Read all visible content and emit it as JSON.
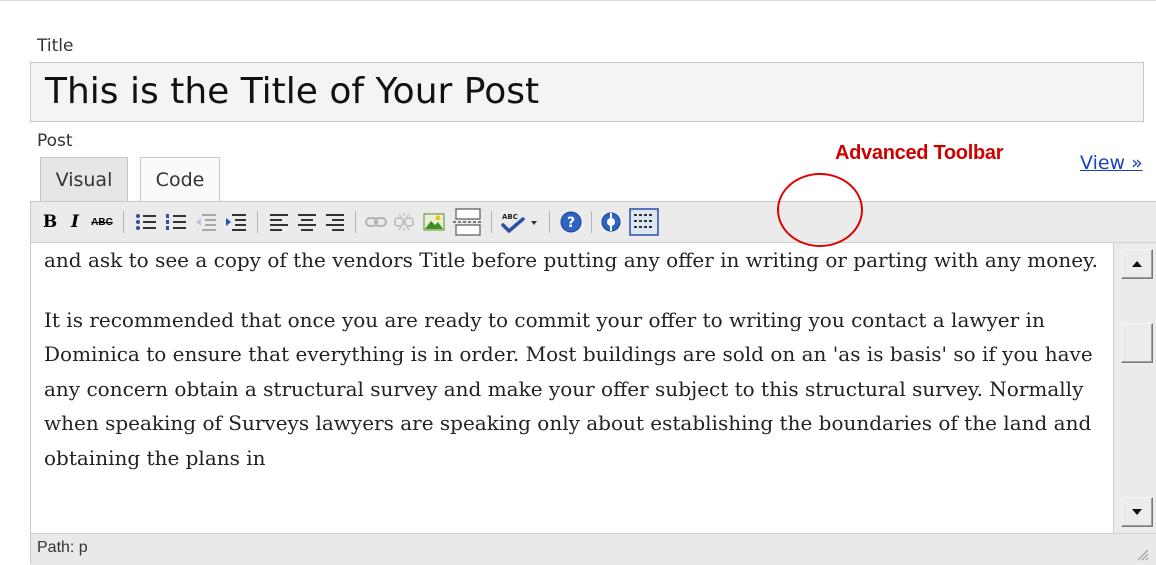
{
  "title_field": {
    "label": "Title",
    "value": "This is the Title of Your Post"
  },
  "post_field": {
    "label": "Post",
    "tabs": [
      {
        "label": "Visual",
        "active": true
      },
      {
        "label": "Code",
        "active": false
      }
    ],
    "view_link": "View »"
  },
  "annotation": {
    "label": "Advanced Toolbar",
    "color": "#e00000"
  },
  "toolbar": {
    "bold": "B",
    "italic": "I",
    "strikethrough": "ABC",
    "icons": [
      "bold-icon",
      "italic-icon",
      "strikethrough-icon",
      "bulleted-list-icon",
      "numbered-list-icon",
      "outdent-icon",
      "indent-icon",
      "align-left-icon",
      "align-center-icon",
      "align-right-icon",
      "link-icon",
      "unlink-icon",
      "insert-image-icon",
      "insert-more-icon",
      "spellcheck-icon",
      "help-icon",
      "fullscreen-icon",
      "advanced-toolbar-icon"
    ]
  },
  "content": {
    "paragraphs": [
      "and ask to see a copy of the vendors Title before putting any offer in writing or parting with any money.",
      "It is recommended that once you are ready to commit your offer to writing you contact a lawyer in Dominica to ensure that everything is in order. Most buildings are sold on an 'as is basis' so if you have any concern obtain a structural survey and make your offer subject to this structural survey. Normally when speaking of Surveys lawyers are speaking only about establishing the boundaries of the land and obtaining the plans in"
    ]
  },
  "status": {
    "path": "Path: p"
  }
}
